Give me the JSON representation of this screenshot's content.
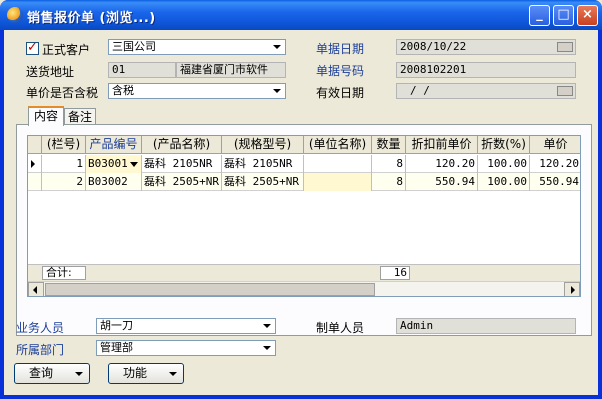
{
  "window": {
    "title": "销售报价单 (浏览...)"
  },
  "form": {
    "customer_type_label": "正式客户",
    "customer_value": "三国公司",
    "doc_date_label": "单据日期",
    "doc_date_value": "2008/10/22",
    "ship_addr_label": "送货地址",
    "ship_addr_code": "01",
    "ship_addr_value": "福建省厦门市软件",
    "doc_no_label": "单据号码",
    "doc_no_value": "2008102201",
    "tax_label": "单价是否含税",
    "tax_value": "含税",
    "valid_date_label": "有效日期",
    "valid_date_value": "/  /"
  },
  "tabs": [
    {
      "label": "内容"
    },
    {
      "label": "备注"
    }
  ],
  "grid": {
    "columns": [
      "(栏号)",
      "产品编号",
      "(产品名称)",
      "(规格型号)",
      "(单位名称)",
      "数量",
      "折扣前单价",
      "折数(%)",
      "单价"
    ],
    "rows": [
      {
        "no": "1",
        "code": "B03001",
        "name": "磊科 2105NR",
        "spec": "磊科 2105NR",
        "unit": "",
        "qty": "8",
        "price_before": "120.20",
        "discount": "100.00",
        "price": "120.20"
      },
      {
        "no": "2",
        "code": "B03002",
        "name": "磊科 2505+NR",
        "spec": "磊科 2505+NR",
        "unit": "",
        "qty": "8",
        "price_before": "550.94",
        "discount": "100.00",
        "price": "550.94"
      }
    ],
    "footer_label": "合计:",
    "footer_qty_total": "16"
  },
  "bottom": {
    "salesperson_label": "业务人员",
    "salesperson_value": "胡一刀",
    "maker_label": "制单人员",
    "maker_value": "Admin",
    "dept_label": "所属部门",
    "dept_value": "管理部",
    "query_button": "查询",
    "function_button": "功能"
  }
}
